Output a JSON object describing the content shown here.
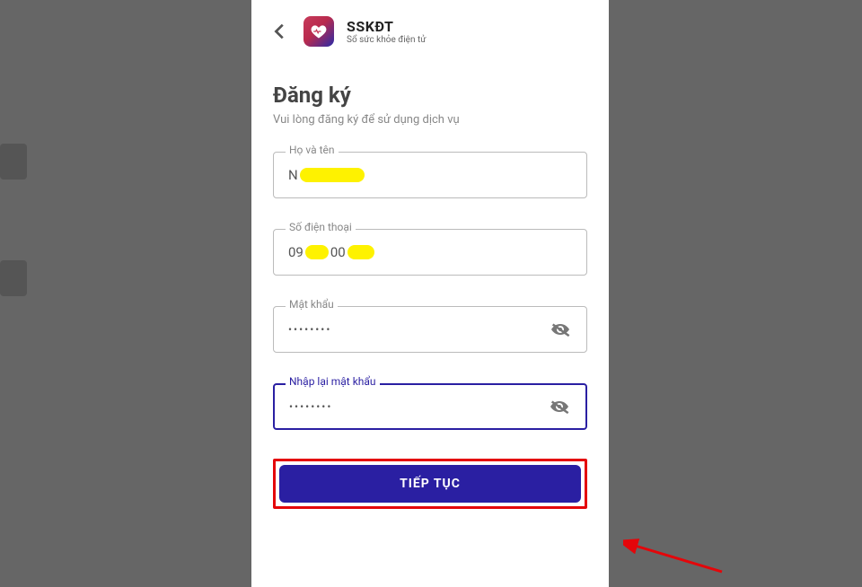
{
  "app": {
    "name": "SSKĐT",
    "subtitle": "Sổ sức khỏe điện tử"
  },
  "page": {
    "title": "Đăng ký",
    "subtitle": "Vui lòng đăng ký để sử dụng dịch vụ"
  },
  "fields": {
    "fullname": {
      "label": "Họ và tên",
      "value_prefix": "N",
      "redacted": true
    },
    "phone": {
      "label": "Số điện thoại",
      "value_part1": "09",
      "value_part2": "00",
      "redacted": true
    },
    "password": {
      "label": "Mật khẩu",
      "value": "••••••••"
    },
    "confirm": {
      "label": "Nhập lại mật khẩu",
      "value": "••••••••"
    }
  },
  "actions": {
    "submit": "TIẾP TỤC"
  }
}
